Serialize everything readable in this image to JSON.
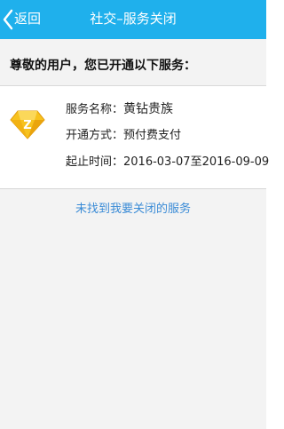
{
  "header": {
    "back_label": "返回",
    "title": "社交–服务关闭",
    "bg_color": "#1fb0ec"
  },
  "greeting": "尊敬的用户，您已开通以下服务：",
  "service": {
    "icon": "yellow-diamond-icon",
    "name_label": "服务名称：",
    "name_value": "黄钻贵族",
    "method_label": "开通方式：",
    "method_value": "预付费支付",
    "period_label": "起止时间：",
    "period_value": "2016-03-07至2016-09-09"
  },
  "link_text": "未找到我要关闭的服务",
  "colors": {
    "accent": "#1fb0ec",
    "link": "#3a8bd6",
    "background": "#f3f3f3"
  }
}
